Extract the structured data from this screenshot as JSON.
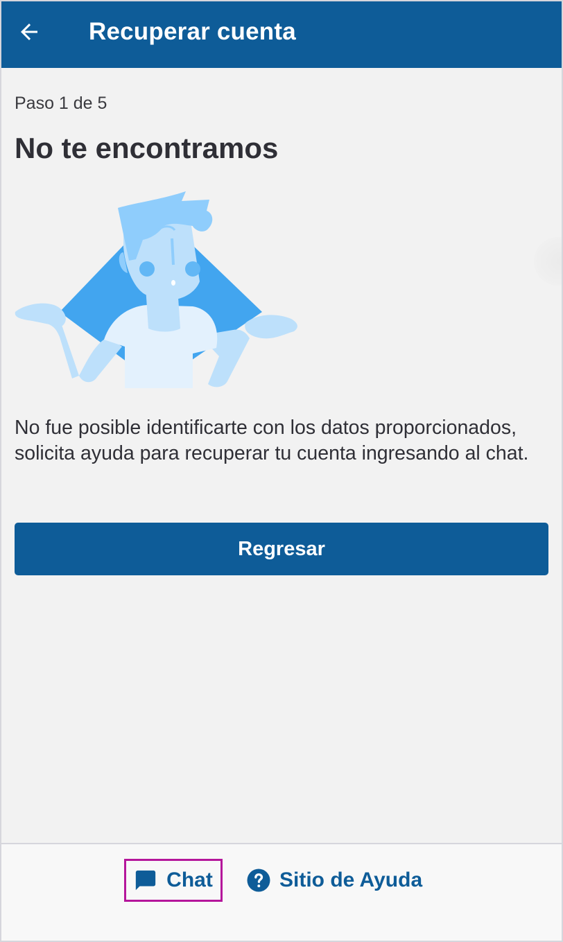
{
  "appbar": {
    "title": "Recuperar cuenta",
    "back_icon": "arrow-left-icon",
    "color": "#0e5c98"
  },
  "content": {
    "step": "Paso 1 de 5",
    "heading": "No te encontramos",
    "illustration_icon": "shrugging-person-illustration",
    "message": "No fue posible identificarte con los datos proporcionados, solicita ayuda para recuperar tu cuenta ingresando al chat.",
    "primary_button": "Regresar"
  },
  "footer": {
    "chat_label": "Chat",
    "chat_icon": "chat-bubble-icon",
    "help_label": "Sitio de Ayuda",
    "help_icon": "question-circle-icon",
    "highlight_color": "#b5169b"
  }
}
